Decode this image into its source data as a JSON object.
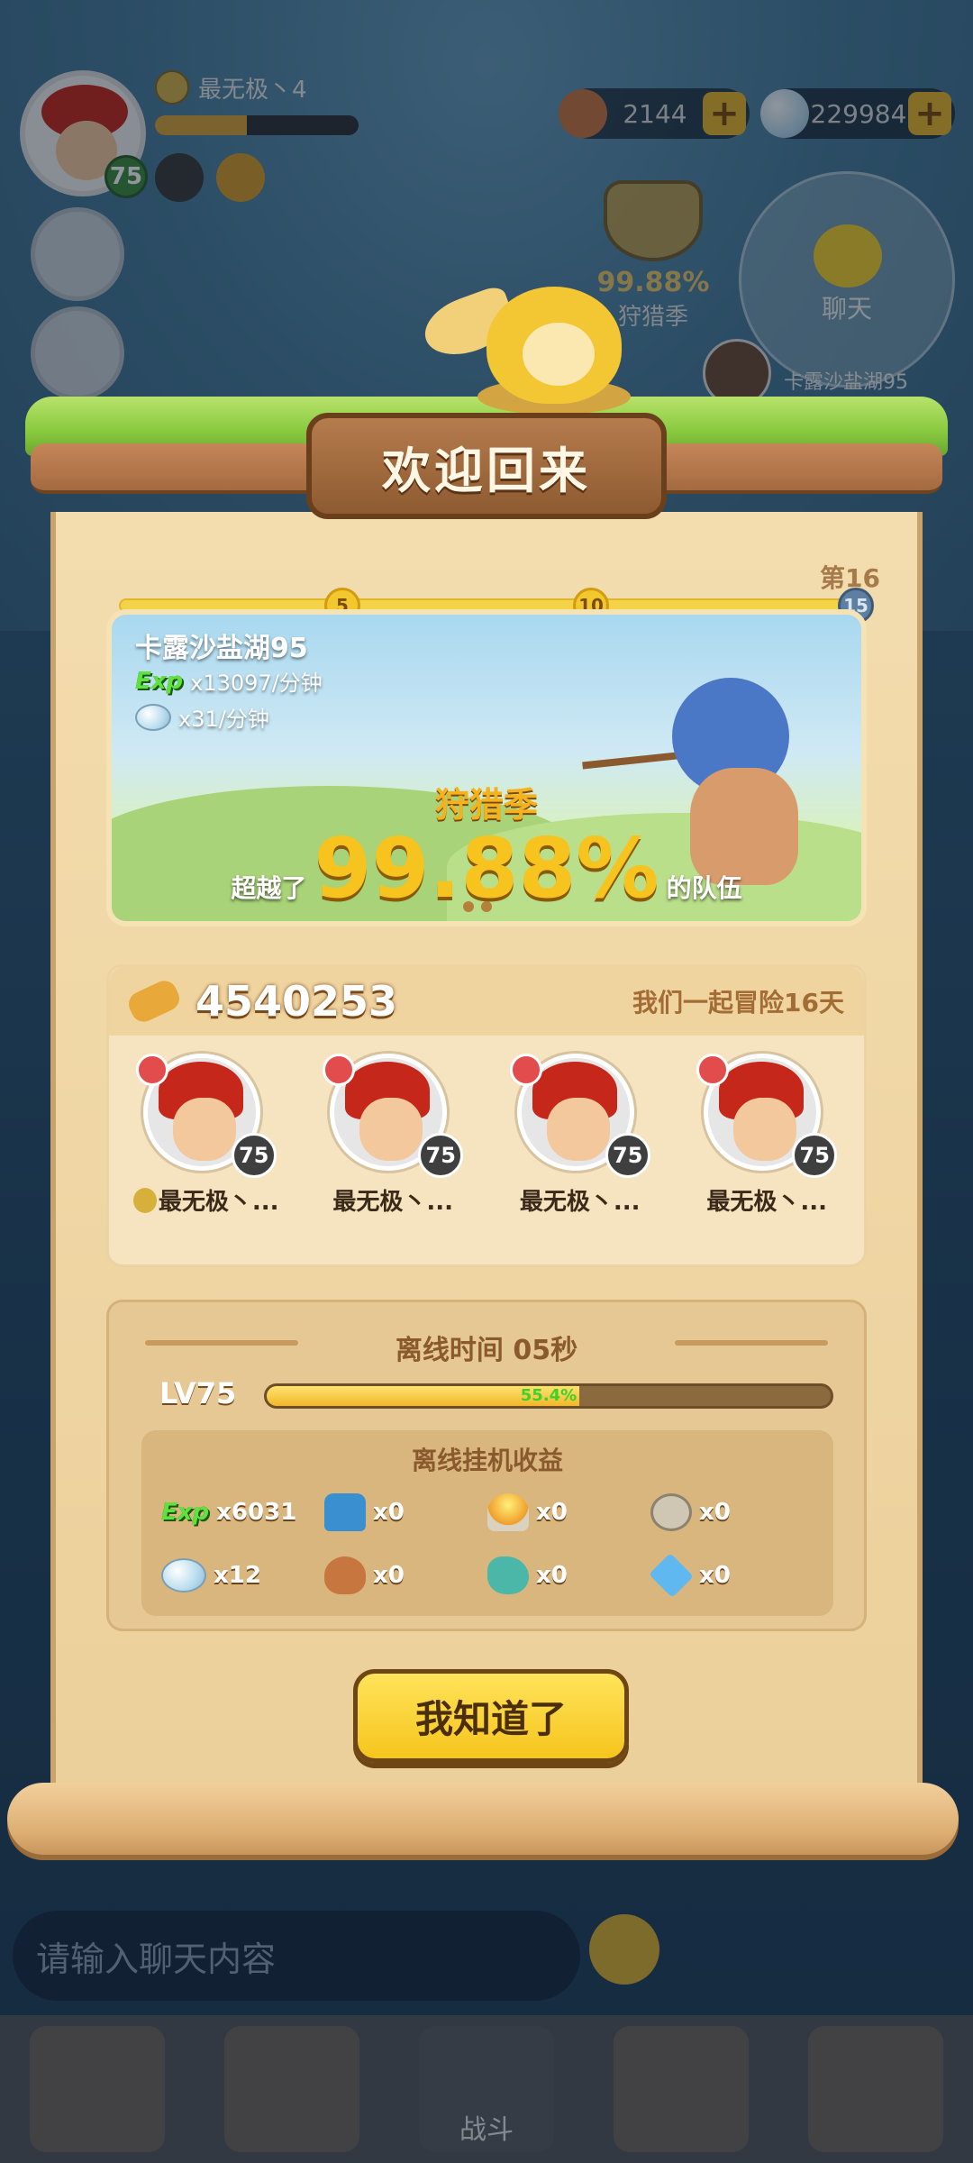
{
  "hud": {
    "player_name": "最无极丶4",
    "player_level": "75",
    "exp_fill": 0.45,
    "currency_meat": "2144",
    "currency_gem": "229984",
    "plus": "+",
    "season_percent": "99.88%",
    "season_label": "狩猎季",
    "chat_label": "聊天",
    "map_name": "卡露沙盐湖95",
    "chat_input_placeholder": "请输入聊天内容",
    "nav_battle": "战斗"
  },
  "dialog": {
    "title": "欢迎回来",
    "stage_label": "第16",
    "milestones": [
      "5",
      "10",
      "15"
    ],
    "banner": {
      "map": "卡露沙盐湖95",
      "exp_tag": "Exp",
      "exp_rate": "x13097/分钟",
      "gem_rate": "x31/分钟",
      "season": "狩猎季",
      "surpass_prefix": "超越了",
      "surpass_value": "99.88%",
      "surpass_suffix": "的队伍"
    },
    "team": {
      "power": "4540253",
      "adventure_days": "我们一起冒险16天",
      "members": [
        {
          "name": "最无极丶...",
          "level": "75"
        },
        {
          "name": "最无极丶...",
          "level": "75"
        },
        {
          "name": "最无极丶...",
          "level": "75"
        },
        {
          "name": "最无极丶...",
          "level": "75"
        }
      ]
    },
    "offline": {
      "title": "离线时间 05秒",
      "level_label": "LV75",
      "level_progress": 0.554,
      "level_progress_text": "55.4%",
      "income_title": "离线挂机收益",
      "items": [
        {
          "icon": "exp-icon",
          "value": "x6031"
        },
        {
          "icon": "shirt-icon",
          "value": "x0"
        },
        {
          "icon": "fire-stone-icon",
          "value": "x0"
        },
        {
          "icon": "stone-ring-icon",
          "value": "x0"
        },
        {
          "icon": "gem-icon",
          "value": "x12"
        },
        {
          "icon": "meat-icon",
          "value": "x0"
        },
        {
          "icon": "ore-icon",
          "value": "x0"
        },
        {
          "icon": "crystal-icon",
          "value": "x0"
        }
      ]
    },
    "ok_button": "我知道了"
  },
  "colors": {
    "accent_gold": "#f6c51d",
    "parchment": "#efd6a4",
    "exp_green": "#5fe23e"
  }
}
